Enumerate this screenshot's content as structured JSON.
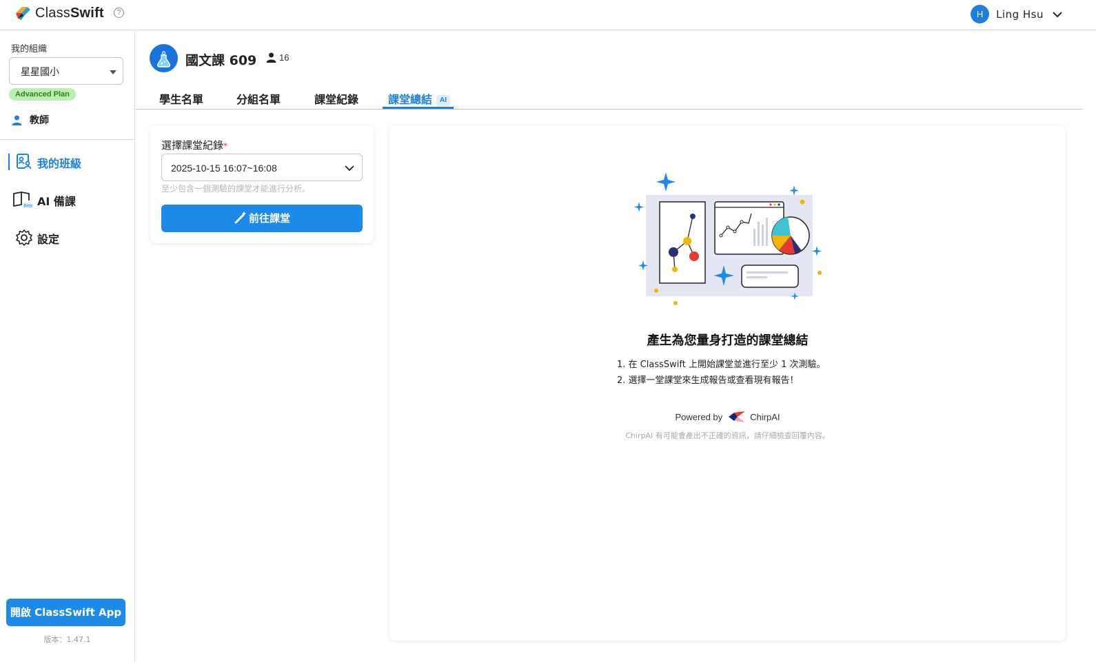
{
  "app": {
    "logo_text_plain": "Class",
    "logo_text_bold": "Swift",
    "help_symbol": "?"
  },
  "user": {
    "initial": "H",
    "name": "Ling Hsu"
  },
  "sidebar": {
    "org_label": "我的組織",
    "org_selected": "星星國小",
    "plan_badge": "Advanced Plan",
    "role_label": "教師",
    "nav": [
      {
        "label": "我的班級",
        "icon": "class-roster-icon",
        "active": true
      },
      {
        "label": "AI 備課",
        "icon": "ai-lesson-book-icon",
        "badge": "Beta"
      },
      {
        "label": "設定",
        "icon": "gear-icon"
      }
    ],
    "open_app_label": "開啟 ClassSwift App",
    "version": "版本：1.47.1"
  },
  "class_header": {
    "title": "國文課 609",
    "member_count": "16"
  },
  "tabs": [
    {
      "label": "學生名單"
    },
    {
      "label": "分組名單"
    },
    {
      "label": "課堂紀錄"
    },
    {
      "label": "課堂總結",
      "badge": "AI",
      "active": true
    }
  ],
  "record_card": {
    "label": "選擇課堂紀錄",
    "required_mark": "*",
    "selected_record": "2025-10-15 16:07~16:08",
    "hint": "至少包含一個測驗的課堂才能進行分析。",
    "go_button": "前往課堂"
  },
  "summary": {
    "title": "產生為您量身打造的課堂總結",
    "steps": [
      "1. 在 ClassSwift 上開始課堂並進行至少 1 次測驗。",
      "2. 選擇一堂課堂來生成報告或查看現有報告！"
    ],
    "powered_by": "Powered by",
    "provider": "ChirpAI",
    "disclaimer": "ChirpAI 有可能會產出不正確的資訊，請仔細檢查回覆內容。"
  },
  "colors": {
    "primary": "#1c7fe0",
    "button": "#1c8ae8",
    "plan_badge_bg": "#b9efb0",
    "plan_badge_text": "#2f7d1f"
  }
}
